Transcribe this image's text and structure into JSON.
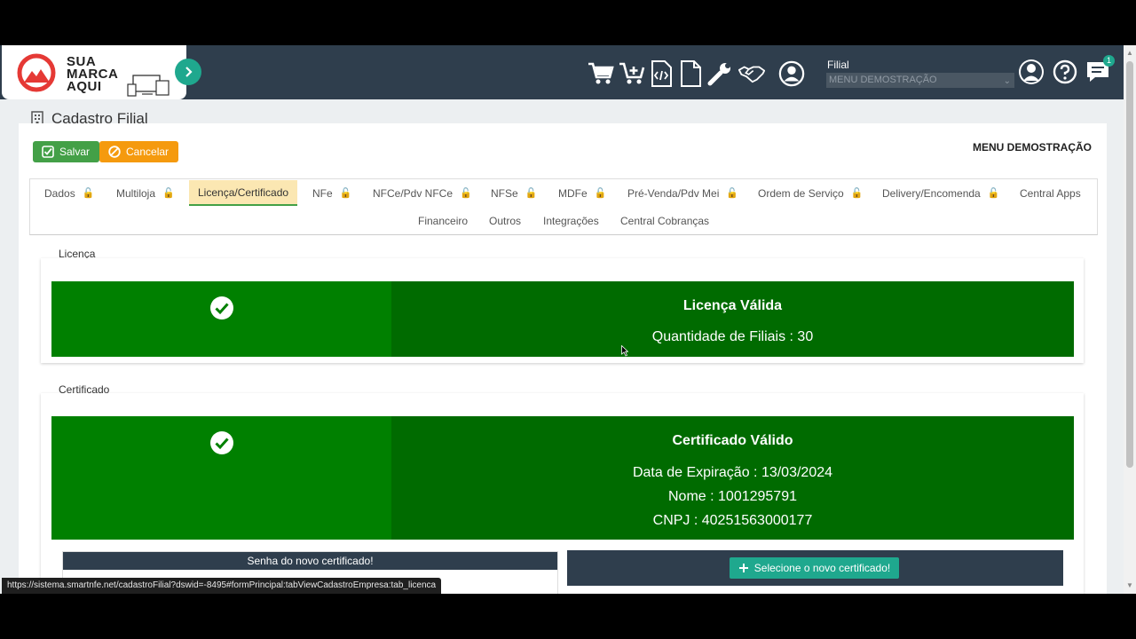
{
  "header": {
    "logo_lines": [
      "SUA",
      "MARCA",
      "AQUI"
    ],
    "filial_label": "Filial",
    "filial_value": "MENU DEMOSTRAÇÃO",
    "notification_count": "1",
    "toolbar_icons": [
      "cart-icon",
      "cart-plus-icon",
      "code-file-icon",
      "file-icon",
      "wrench-icon",
      "handshake-icon",
      "user-circle-icon"
    ],
    "right_icons": [
      "user-avatar-icon",
      "help-icon",
      "chat-icon"
    ]
  },
  "page": {
    "title": "Cadastro Filial",
    "save_label": "Salvar",
    "cancel_label": "Cancelar",
    "company_name": "MENU DEMOSTRAÇÃO"
  },
  "tabs": [
    {
      "label": "Dados",
      "locked": true
    },
    {
      "label": "Multiloja",
      "locked": true
    },
    {
      "label": "Licença/Certificado",
      "locked": false,
      "active": true
    },
    {
      "label": "NFe",
      "locked": true
    },
    {
      "label": "NFCe/Pdv NFCe",
      "locked": true
    },
    {
      "label": "NFSe",
      "locked": true
    },
    {
      "label": "MDFe",
      "locked": true
    },
    {
      "label": "Pré-Venda/Pdv Mei",
      "locked": true
    },
    {
      "label": "Ordem de Serviço",
      "locked": true
    },
    {
      "label": "Delivery/Encomenda",
      "locked": true
    },
    {
      "label": "Central Apps",
      "locked": false
    },
    {
      "label": "Financeiro",
      "locked": false
    },
    {
      "label": "Outros",
      "locked": false
    },
    {
      "label": "Integrações",
      "locked": false
    },
    {
      "label": "Central Cobranças",
      "locked": false
    }
  ],
  "license": {
    "section_label": "Licença",
    "title": "Licença Válida",
    "branches": "Quantidade de Filiais : 30"
  },
  "certificate": {
    "section_label": "Certificado",
    "title": "Certificado Válido",
    "expiration": "Data de Expiração : 13/03/2024",
    "name": "Nome : 1001295791",
    "cnpj": "CNPJ : 40251563000177",
    "password_header": "Senha do novo certificado!",
    "select_button": "Selecione o novo certificado!"
  },
  "status_bar": {
    "url": "https://sistema.smartnfe.net/cadastroFilial?dswid=-8495#formPrincipal:tabViewCadastroEmpresa:tab_licenca"
  },
  "colors": {
    "header_bg": "#2f3e4d",
    "accent": "#1fa88e",
    "valid_green": "#008000",
    "valid_green_dark": "#006b00",
    "save": "#43a047",
    "cancel": "#f59a0e",
    "active_tab": "#fbe7b2"
  }
}
